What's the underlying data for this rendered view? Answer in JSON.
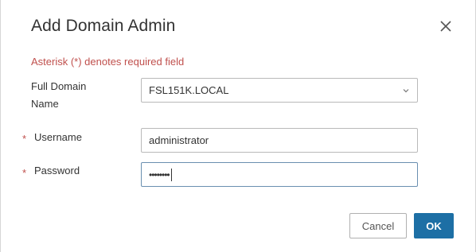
{
  "dialog": {
    "title": "Add Domain Admin",
    "close_icon": "close-icon"
  },
  "form": {
    "required_note": "Asterisk (*) denotes required field",
    "domain": {
      "label_line1": "Full Domain",
      "label_line2": "Name",
      "value": "FSL151K.LOCAL",
      "icon": "chevron-down-icon"
    },
    "username": {
      "asterisk": "*",
      "label": "Username",
      "value": "administrator"
    },
    "password": {
      "asterisk": "*",
      "label": "Password",
      "value": "••••••••"
    }
  },
  "buttons": {
    "cancel_label": "Cancel",
    "ok_label": "OK"
  },
  "colors": {
    "required_red": "#c0504d",
    "primary_blue": "#1d6fa5"
  }
}
